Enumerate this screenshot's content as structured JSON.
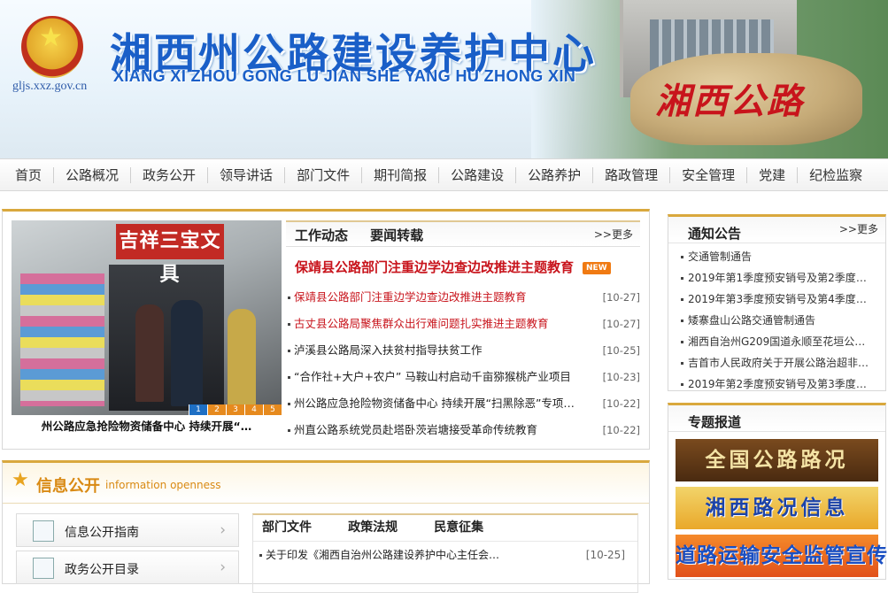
{
  "header": {
    "title_cn": "湘西州公路建设养护中心",
    "title_py": "XIANG XI ZHOU GONG LU JIAN SHE YANG HU ZHONG XIN",
    "domain": "gljs.xxz.gov.cn",
    "rock_text": "湘西公路"
  },
  "nav": [
    "首页",
    "公路概况",
    "政务公开",
    "领导讲话",
    "部门文件",
    "期刊简报",
    "公路建设",
    "公路养护",
    "路政管理",
    "安全管理",
    "党建",
    "纪检监察"
  ],
  "slideshow": {
    "caption": "州公路应急抢险物资储备中心 持续开展“…",
    "sign": "吉祥三宝文具",
    "dots": [
      "1",
      "2",
      "3",
      "4",
      "5"
    ],
    "active_dot": 0
  },
  "news": {
    "tabs": [
      "工作动态",
      "要闻转载"
    ],
    "more": ">>更多",
    "headline": "保靖县公路部门注重边学边查边改推进主题教育",
    "badge": "NEW",
    "items": [
      {
        "title": "保靖县公路部门注重边学边查边改推进主题教育",
        "date": "[10-27]",
        "red": true
      },
      {
        "title": "古丈县公路局聚焦群众出行难问题扎实推进主题教育",
        "date": "[10-27]",
        "red": true
      },
      {
        "title": "泸溪县公路局深入扶贫村指导扶贫工作",
        "date": "[10-25]",
        "red": false
      },
      {
        "title": "“合作社+大户+农户” 马鞍山村启动千亩猕猴桃产业项目",
        "date": "[10-23]",
        "red": false
      },
      {
        "title": "州公路应急抢险物资储备中心 持续开展“扫黑除恶”专项…",
        "date": "[10-22]",
        "red": false
      },
      {
        "title": "州直公路系统党员赴塔卧茨岩塘接受革命传统教育",
        "date": "[10-22]",
        "red": false
      }
    ]
  },
  "notice": {
    "title": "通知公告",
    "more": ">>更多",
    "items": [
      "交通管制通告",
      "2019年第1季度预安销号及第2季度工…",
      "2019年第3季度预安销号及第4季度工…",
      "矮寨盘山公路交通管制通告",
      "湘西自治州G209国道永顺至花垣公路…",
      "吉首市人民政府关于开展公路治超非…",
      "2019年第2季度预安销号及第3季度工…"
    ]
  },
  "topic": {
    "title": "专题报道",
    "banners": [
      "全国公路路况",
      "湘西路况信息",
      "道路运输安全监管宣传"
    ]
  },
  "info": {
    "title": "信息公开",
    "subtitle": "information openness",
    "side": [
      "信息公开指南",
      "政务公开目录"
    ],
    "tabs": [
      "部门文件",
      "政策法规",
      "民意征集"
    ],
    "row": {
      "title": "关于印发《湘西自治州公路建设养护中心主任会…",
      "date": "[10-25]"
    }
  }
}
